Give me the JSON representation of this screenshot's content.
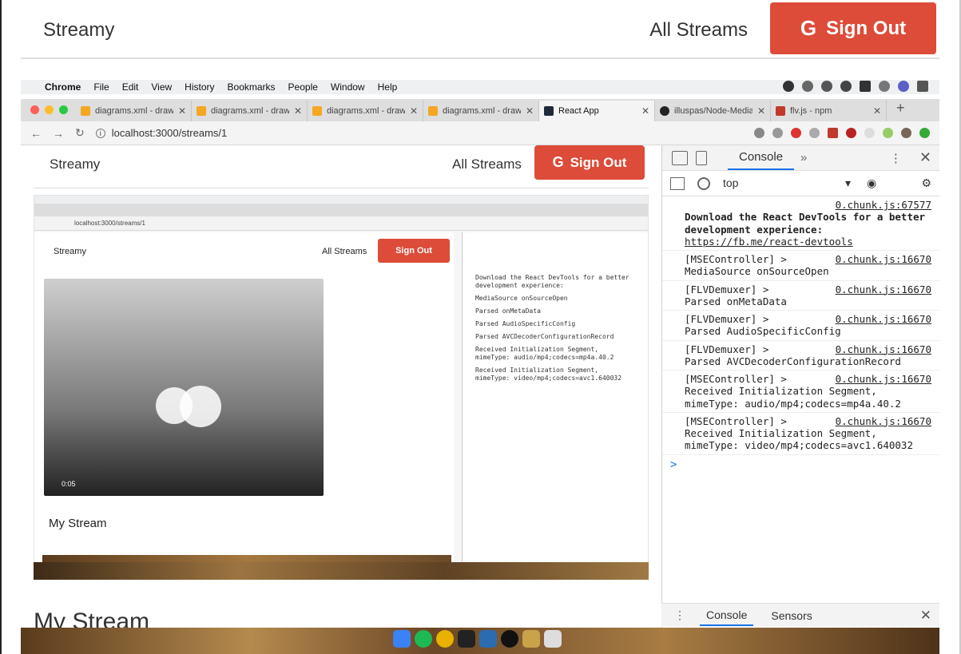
{
  "app": {
    "brand": "Streamy",
    "nav_link": "All Streams",
    "signout_label": "Sign Out",
    "google_glyph": "G",
    "brand_color": "#dd4b39"
  },
  "menubar": {
    "items": [
      "Chrome",
      "File",
      "Edit",
      "View",
      "History",
      "Bookmarks",
      "People",
      "Window",
      "Help"
    ]
  },
  "tabs": [
    {
      "title": "diagrams.xml - draw",
      "icon": "drawio-icon",
      "active": false
    },
    {
      "title": "diagrams.xml - draw",
      "icon": "drawio-icon",
      "active": false
    },
    {
      "title": "diagrams.xml - draw",
      "icon": "drawio-icon",
      "active": false
    },
    {
      "title": "diagrams.xml - draw",
      "icon": "drawio-icon",
      "active": false
    },
    {
      "title": "React App",
      "icon": "react-icon",
      "active": true
    },
    {
      "title": "illuspas/Node-Media",
      "icon": "github-icon",
      "active": false
    },
    {
      "title": "flv.js - npm",
      "icon": "npm-icon",
      "active": false
    }
  ],
  "address": {
    "url": "localhost:3000/streams/1"
  },
  "inner": {
    "brand": "Streamy",
    "nav_link": "All Streams",
    "signout_label": "Sign Out",
    "stream_title": "My Stream",
    "video_time": "0:05"
  },
  "devtools": {
    "tab": "Console",
    "more": "»",
    "context": "top",
    "messages": [
      {
        "prefix": "",
        "src": "0.chunk.js:67577",
        "text": "Download the React DevTools for a better development experience: ",
        "link": "https://fb.me/react-devtools",
        "bold": true
      },
      {
        "prefix": "[MSEController] >",
        "src": "0.chunk.js:16670",
        "text": "MediaSource onSourceOpen"
      },
      {
        "prefix": "[FLVDemuxer] >",
        "src": "0.chunk.js:16670",
        "text": "Parsed onMetaData"
      },
      {
        "prefix": "[FLVDemuxer] >",
        "src": "0.chunk.js:16670",
        "text": "Parsed AudioSpecificConfig"
      },
      {
        "prefix": "[FLVDemuxer] >",
        "src": "0.chunk.js:16670",
        "text": "Parsed AVCDecoderConfigurationRecord"
      },
      {
        "prefix": "[MSEController] >",
        "src": "0.chunk.js:16670",
        "text": "Received Initialization Segment, mimeType: audio/mp4;codecs=mp4a.40.2"
      },
      {
        "prefix": "[MSEController] >",
        "src": "0.chunk.js:16670",
        "text": "Received Initialization Segment, mimeType: video/mp4;codecs=avc1.640032"
      }
    ],
    "prompt": ">",
    "drawer_tabs": [
      "Console",
      "Sensors"
    ]
  }
}
